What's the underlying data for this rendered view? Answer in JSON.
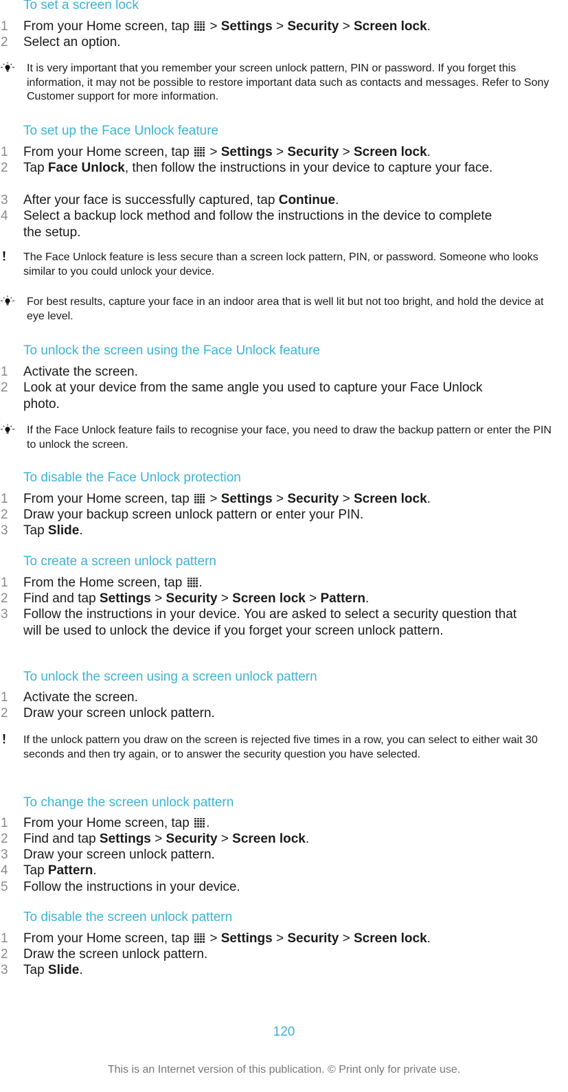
{
  "sections": [
    {
      "title": "To set a screen lock",
      "steps": [
        [
          "1",
          "From your Home screen, tap [ICON] > **Settings** > **Security** > **Screen lock**."
        ],
        [
          "2",
          "Select an option."
        ]
      ],
      "notes": [
        {
          "type": "tip",
          "text": "It is very important that you remember your screen unlock pattern, PIN or password. If you forget this information, it may not be possible to restore important data such as contacts and messages. Refer to Sony Customer support for more information."
        }
      ]
    },
    {
      "title": "To set up the Face Unlock feature",
      "steps": [
        [
          "1",
          "From your Home screen, tap [ICON] > **Settings** > **Security** > **Screen lock**."
        ],
        [
          "2",
          "Tap **Face Unlock**, then follow the instructions in your device to capture your face."
        ],
        [
          "3",
          "After your face is successfully captured, tap **Continue**."
        ],
        [
          "4",
          "Select a backup lock method and follow the instructions in the device to complete the setup."
        ]
      ],
      "notes": [
        {
          "type": "warning",
          "text": "The Face Unlock feature is less secure than a screen lock pattern, PIN, or password. Someone who looks similar to you could unlock your device."
        },
        {
          "type": "tip",
          "text": "For best results, capture your face in an indoor area that is well lit but not too bright, and hold the device at eye level."
        }
      ]
    },
    {
      "title": "To unlock the screen using the Face Unlock feature",
      "steps": [
        [
          "1",
          "Activate the screen."
        ],
        [
          "2",
          "Look at your device from the same angle you used to capture your Face Unlock photo."
        ]
      ],
      "notes": [
        {
          "type": "tip",
          "text": "If the Face Unlock feature fails to recognise your face, you need to draw the backup pattern or enter the PIN to unlock the screen."
        }
      ]
    },
    {
      "title": "To disable the Face Unlock protection",
      "steps": [
        [
          "1",
          "From your Home screen, tap [ICON] > **Settings** > **Security** > **Screen lock**."
        ],
        [
          "2",
          "Draw your backup screen unlock pattern or enter your PIN."
        ],
        [
          "3",
          "Tap **Slide**."
        ]
      ],
      "notes": []
    },
    {
      "title": "To create a screen unlock pattern",
      "steps": [
        [
          "1",
          "From the Home screen, tap [ICON]."
        ],
        [
          "2",
          "Find and tap **Settings** > **Security** > **Screen lock** > **Pattern**."
        ],
        [
          "3",
          "Follow the instructions in your device. You are asked to select a security question that will be used to unlock the device if you forget your screen unlock pattern."
        ]
      ],
      "notes": []
    },
    {
      "title": "To unlock the screen using a screen unlock pattern",
      "steps": [
        [
          "1",
          "Activate the screen."
        ],
        [
          "2",
          "Draw your screen unlock pattern."
        ]
      ],
      "notes": [
        {
          "type": "warning",
          "text": "If the unlock pattern you draw on the screen is rejected five times in a row, you can select to either wait 30 seconds and then try again, or to answer the security question you have selected."
        }
      ]
    },
    {
      "title": "To change the screen unlock pattern",
      "steps": [
        [
          "1",
          "From your Home screen, tap [ICON]."
        ],
        [
          "2",
          "Find and tap **Settings** > **Security** > **Screen lock**."
        ],
        [
          "3",
          "Draw your screen unlock pattern."
        ],
        [
          "4",
          "Tap **Pattern**."
        ],
        [
          "5",
          "Follow the instructions in your device."
        ]
      ],
      "notes": []
    },
    {
      "title": "To disable the screen unlock pattern",
      "steps": [
        [
          "1",
          "From your Home screen, tap [ICON] > **Settings** > **Security** > **Screen lock**."
        ],
        [
          "2",
          "Draw the screen unlock pattern."
        ],
        [
          "3",
          "Tap **Slide**."
        ]
      ],
      "notes": []
    }
  ],
  "page_number": "120",
  "footer": "This is an Internet version of this publication. © Print only for private use.",
  "colors": {
    "heading": "#3ab4d6",
    "step_number": "#8a8a8a",
    "footer": "#777777"
  }
}
